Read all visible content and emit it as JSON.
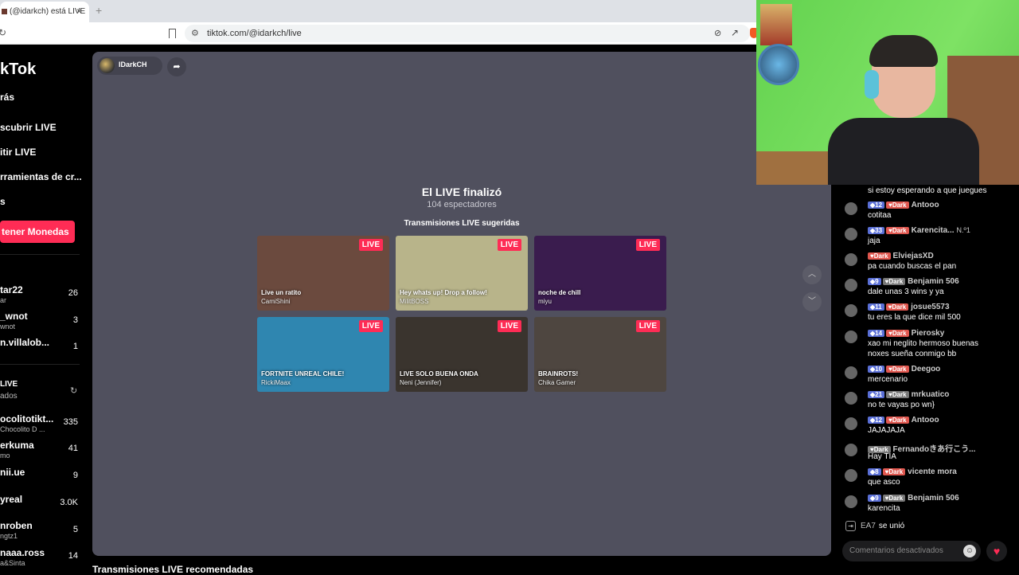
{
  "browser": {
    "tab_title": "(@idarkch) está LIVE",
    "tab_close": "×",
    "new_tab": "+",
    "url": "tiktok.com/@idarkch/live"
  },
  "sidebar": {
    "logo": "kTok",
    "nav": [
      "rás",
      "scubrir LIVE",
      "itir LIVE",
      "rramientas de cr...",
      "s"
    ],
    "coins_button": "tener Monedas",
    "followed": [
      {
        "name": "tar22",
        "sub": "ar",
        "count": "26"
      },
      {
        "name": "_wnot",
        "sub": "wnot",
        "count": "3"
      },
      {
        "name": "n.villalob...",
        "sub": "",
        "count": "1"
      }
    ],
    "live_header": "LIVE",
    "live_sub": "ados",
    "live_accounts": [
      {
        "name": "ocolitotikt...",
        "sub": "Chocolito D ...",
        "count": "335"
      },
      {
        "name": "erkuma",
        "sub": "mo",
        "count": "41"
      },
      {
        "name": "nii.ue",
        "sub": "",
        "count": "9"
      },
      {
        "name": "yreal",
        "sub": "",
        "count": "3.0K"
      },
      {
        "name": "nroben",
        "sub": "ngtz1",
        "count": "5"
      },
      {
        "name": "naaa.ross",
        "sub": "a&Sinta",
        "count": "14"
      }
    ]
  },
  "stage": {
    "host_name": "IDarkCH",
    "ended_title": "El LIVE finalizó",
    "viewers": "104 espectadores",
    "suggested_title": "Transmisiones LIVE sugeridas",
    "badge": "LIVE",
    "cards": [
      {
        "title": "Live un ratito",
        "host": "CamiShini",
        "bg": "#6b4a3e"
      },
      {
        "title": "Hey whats up! Drop a follow!",
        "host": "MilitBOSS",
        "bg": "#b8b48a"
      },
      {
        "title": "noche de chill",
        "host": "miyu",
        "bg": "#3a1c4e"
      },
      {
        "title": "FORTNITE UNREAL CHILE!",
        "host": "RickiMaax",
        "bg": "#2f86b0"
      },
      {
        "title": "LIVE SOLO BUENA ONDA",
        "host": "Neni (Jennifer)",
        "bg": "#3a342e"
      },
      {
        "title": "BRAINROTS!",
        "host": "Chika Gamer",
        "bg": "#4e4640"
      }
    ],
    "recommended_title": "Transmisiones LIVE recomendadas"
  },
  "chat": {
    "first_message": "si estoy esperando a que juegues",
    "messages": [
      {
        "level": "12",
        "fan": "Dark",
        "fan_grey": false,
        "user": "Antooo",
        "extra": "",
        "text": "cotitaa"
      },
      {
        "level": "33",
        "fan": "Dark",
        "fan_grey": false,
        "user": "Karencita...",
        "extra": "N.º1",
        "text": "jaja"
      },
      {
        "level": "",
        "fan": "Dark",
        "fan_grey": false,
        "user": "ElviejasXD",
        "extra": "",
        "text": "pa cuando buscas el pan"
      },
      {
        "level": "9",
        "fan": "Dark",
        "fan_grey": true,
        "user": "Benjamin 506",
        "extra": "",
        "text": "dale unas 3 wins y ya"
      },
      {
        "level": "11",
        "fan": "Dark",
        "fan_grey": false,
        "user": "josue5573",
        "extra": "",
        "text": "tu eres la que dice mil 500"
      },
      {
        "level": "14",
        "fan": "Dark",
        "fan_grey": false,
        "user": "Pierosky",
        "extra": "",
        "text": "xao mi neglito hermoso buenas"
      },
      {
        "level": "10",
        "fan": "Dark",
        "fan_grey": false,
        "user": "Deegoo",
        "extra": "",
        "text": "mercenario"
      },
      {
        "level": "21",
        "fan": "Dark",
        "fan_grey": true,
        "user": "mrkuatico",
        "extra": "",
        "text": "no te vayas po wn}"
      },
      {
        "level": "12",
        "fan": "Dark",
        "fan_grey": false,
        "user": "Antooo",
        "extra": "",
        "text": "JAJAJAJA"
      },
      {
        "level": "",
        "fan": "Dark",
        "fan_grey": true,
        "user": "Fernandoきあ行こう...",
        "extra": "",
        "text": "Hay TIA"
      },
      {
        "level": "8",
        "fan": "Dark",
        "fan_grey": false,
        "user": "vicente mora",
        "extra": "",
        "text": "que asco"
      },
      {
        "level": "9",
        "fan": "Dark",
        "fan_grey": true,
        "user": "Benjamin 506",
        "extra": "",
        "text": "karencita"
      }
    ],
    "pierosky_line2": "noxes sueña conmigo bb",
    "join_user": "EA7",
    "join_text": "se unió",
    "comment_placeholder": "Comentarios desactivados"
  }
}
